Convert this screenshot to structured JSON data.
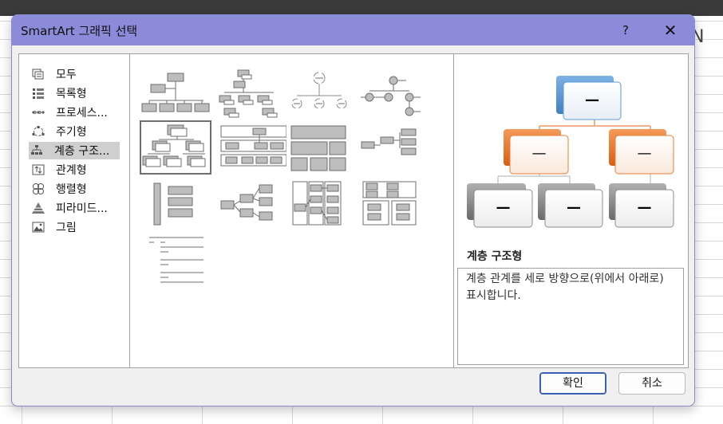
{
  "dialog": {
    "title": "SmartArt 그래픽 선택",
    "help_label": "?",
    "close_label": "✕"
  },
  "background": {
    "partial_letter": "N"
  },
  "categories": [
    {
      "label": "모두",
      "icon": "all-icon",
      "selected": false
    },
    {
      "label": "목록형",
      "icon": "list-icon",
      "selected": false
    },
    {
      "label": "프로세스...",
      "icon": "process-icon",
      "selected": false
    },
    {
      "label": "주기형",
      "icon": "cycle-icon",
      "selected": false
    },
    {
      "label": "계층 구조...",
      "icon": "hierarchy-icon",
      "selected": true
    },
    {
      "label": "관계형",
      "icon": "relationship-icon",
      "selected": false
    },
    {
      "label": "행렬형",
      "icon": "matrix-icon",
      "selected": false
    },
    {
      "label": "피라미드...",
      "icon": "pyramid-icon",
      "selected": false
    },
    {
      "label": "그림",
      "icon": "picture-icon",
      "selected": false
    }
  ],
  "preview": {
    "title": "계층 구조형",
    "description": "계층 관계를 세로 방향으로(위에서 아래로) 표시합니다.",
    "node_text": "—",
    "colors": {
      "top": "#5b9bd5",
      "mid": "#ed7d31",
      "bottom": "#8c8c8c"
    }
  },
  "buttons": {
    "ok": "확인",
    "cancel": "취소"
  }
}
